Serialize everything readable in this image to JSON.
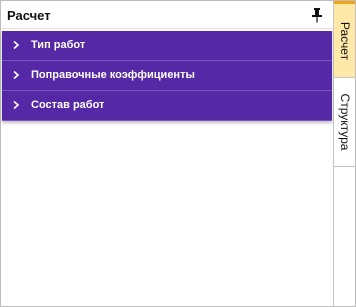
{
  "panel": {
    "title": "Расчет",
    "pin_icon": "pin-icon",
    "sections": [
      {
        "label": "Тип работ",
        "icon": "chevron-right-icon"
      },
      {
        "label": "Поправочные коэффициенты",
        "icon": "chevron-right-icon"
      },
      {
        "label": "Состав работ",
        "icon": "chevron-right-icon"
      }
    ]
  },
  "tabs": [
    {
      "label": "Расчет",
      "active": true
    },
    {
      "label": "Структура",
      "active": false
    }
  ],
  "colors": {
    "accordion_bg": "#5529a5",
    "active_tab_bg": "#ffe8a8",
    "active_tab_accent": "#f3a417"
  }
}
